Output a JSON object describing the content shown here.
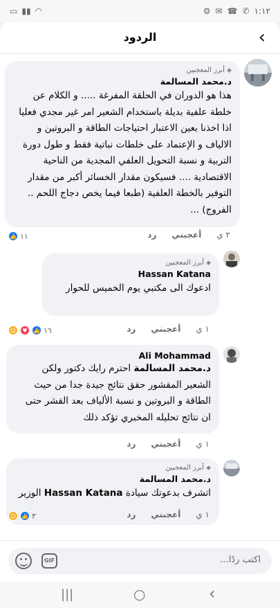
{
  "status_bar": {
    "time": "١:١٢",
    "icons": [
      "whatsapp-icon",
      "phone-icon",
      "battery-icon",
      "wifi-icon",
      "signal-icon"
    ]
  },
  "header": {
    "title": "الردود",
    "back_icon": "chevron-left-icon"
  },
  "comments": [
    {
      "badge": "أبرز المعجبين",
      "author": "د.محمد المسالمة",
      "text": "هذا هو الدوران في الحلقة المفرغة ..... و الكلام عن خلطة علفية بديلة باستخدام الشعير امر غير مجدي فعليا اذا اخذنا بعين الاعتبار احتياجات الطاقة و البروتين و الالياف و الإعتماد على خلطات نباتية فقط و طول دورة التربية و نسبة التحويل العلفي المجدية من الناحية الاقتصادية .... فسيكون مقدار الخسائر أكبر من مقدار التوفير بالخطة العلفية (طبعا فيما يخص دجاج اللحم .. الفروج) ...",
      "time": "٢ ي",
      "like": "أعجبني",
      "reply": "رد",
      "reaction_count": "١١"
    },
    {
      "badge": "أبرز المعجبين",
      "author": "Hassan Katana",
      "text": "ادعوك الى مكتبي يوم الخميس للحوار",
      "time": "١ ي",
      "like": "أعجبني",
      "reply": "رد",
      "reaction_count": "١٦"
    },
    {
      "author": "Ali Mohammad",
      "tag": "د.محمد المسالمة",
      "text": "احترم رايك دكتور ولكن الشعير المقشور حقق نتائج جيدة جدا من حيث الطاقة و البروتين و نسبة الألياف بعد القشر حتى ان نتائج تحليله المخبري تؤكد ذلك",
      "time": "١ ي",
      "like": "أعجبني",
      "reply": "رد"
    },
    {
      "badge": "أبرز المعجبين",
      "author": "د.محمد المسالمة",
      "text_before": "اتشرف بدعوتك سيادة",
      "tag": "Hassan Katana",
      "text_after": "الوزير",
      "time": "١ ي",
      "like": "أعجبني",
      "reply": "رد",
      "reaction_count": "٣"
    }
  ],
  "composer": {
    "placeholder": "اكتب ردًا...",
    "gif_label": "GIF"
  },
  "nav": {
    "recents": "|||",
    "home": "○",
    "back": "‹"
  }
}
